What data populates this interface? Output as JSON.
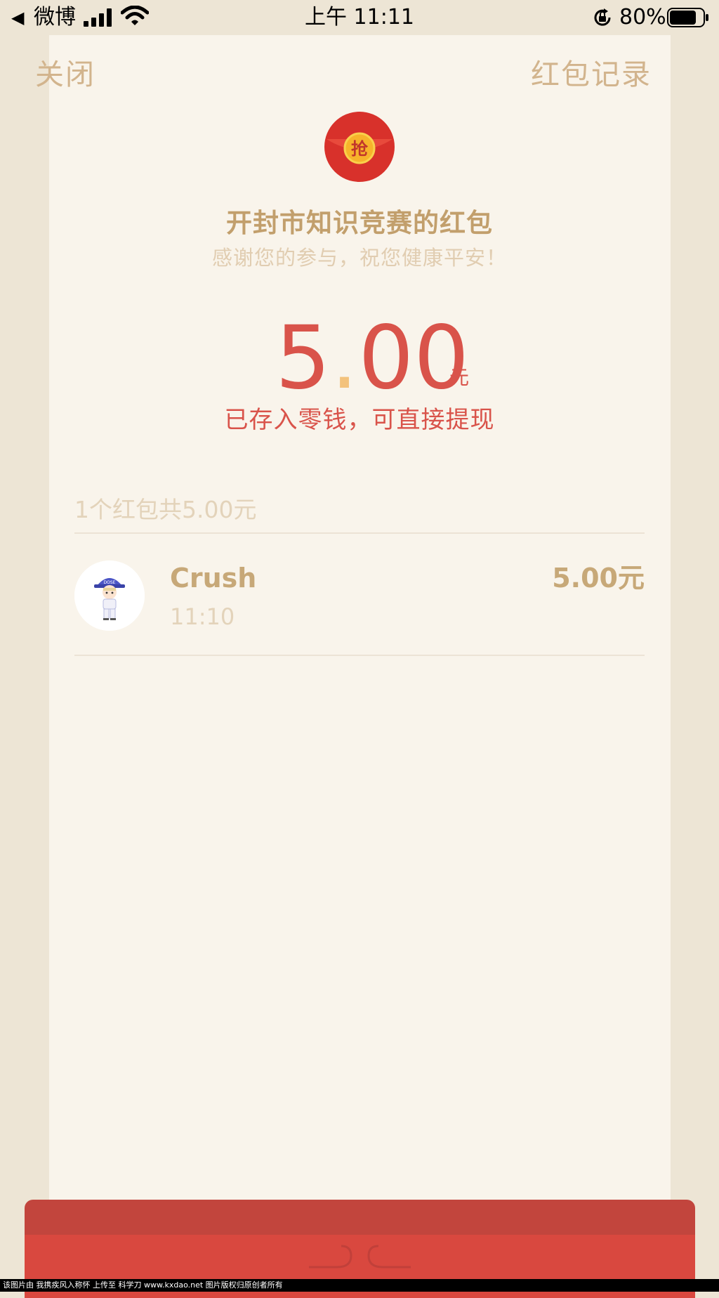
{
  "status_bar": {
    "back_glyph": "◀",
    "back_app": "微博",
    "time": "上午 11:11",
    "battery_percent": "80%",
    "battery_level": 0.8,
    "icons": [
      "signal-icon",
      "wifi-icon",
      "orientation-lock-icon",
      "battery-icon"
    ]
  },
  "header": {
    "close_label": "关闭",
    "records_label": "红包记录"
  },
  "envelope": {
    "logo_glyph": "抢",
    "sender_title": "开封市知识竞赛的红包",
    "greeting": "感谢您的参与，祝您健康平安！"
  },
  "amount": {
    "integer": "5",
    "dot": ".",
    "decimal": "00",
    "unit": "元",
    "stored_note": "已存入零钱，可直接提现"
  },
  "summary": {
    "text": "1个红包共5.00元"
  },
  "records": [
    {
      "name": "Crush",
      "time": "11:10",
      "amount": "5.00元"
    }
  ],
  "watermark": {
    "text": "该图片由 我携疾风入称怀 上传至 科学刀 www.kxdao.net 图片版权归原创者所有"
  },
  "colors": {
    "background": "#ede5d5",
    "card": "#f9f4eb",
    "gold": "#c29f6c",
    "red": "#d9534a",
    "envelope_red": "#d9483f"
  }
}
